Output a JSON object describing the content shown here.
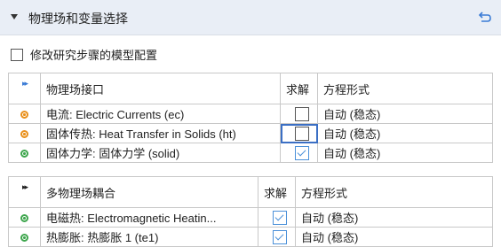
{
  "header": {
    "title": "物理场和变量选择"
  },
  "modify_option": {
    "label": "修改研究步骤的模型配置",
    "checked": false
  },
  "physics_table": {
    "columns": [
      "物理场接口",
      "求解",
      "方程形式"
    ],
    "rows": [
      {
        "name": "电流: Electric Currents (ec)",
        "status": "orange",
        "solve": false,
        "form": "自动 (稳态)"
      },
      {
        "name": "固体传热: Heat Transfer in Solids (ht)",
        "status": "orange",
        "solve": false,
        "form": "自动 (稳态)"
      },
      {
        "name": "固体力学: 固体力学 (solid)",
        "status": "green",
        "solve": true,
        "form": "自动 (稳态)"
      }
    ]
  },
  "multiphysics_table": {
    "columns": [
      "多物理场耦合",
      "求解",
      "方程形式"
    ],
    "rows": [
      {
        "name": "电磁热: Electromagnetic Heatin...",
        "status": "green",
        "solve": true,
        "form": "自动 (稳态)"
      },
      {
        "name": "热膨胀: 热膨胀 1 (te1)",
        "status": "green",
        "solve": true,
        "form": "自动 (稳态)"
      }
    ]
  },
  "colors": {
    "header_bg": "#e9eef6",
    "status_orange": "#e9901b",
    "status_green": "#3ea64d",
    "accent": "#3a7bd5"
  }
}
